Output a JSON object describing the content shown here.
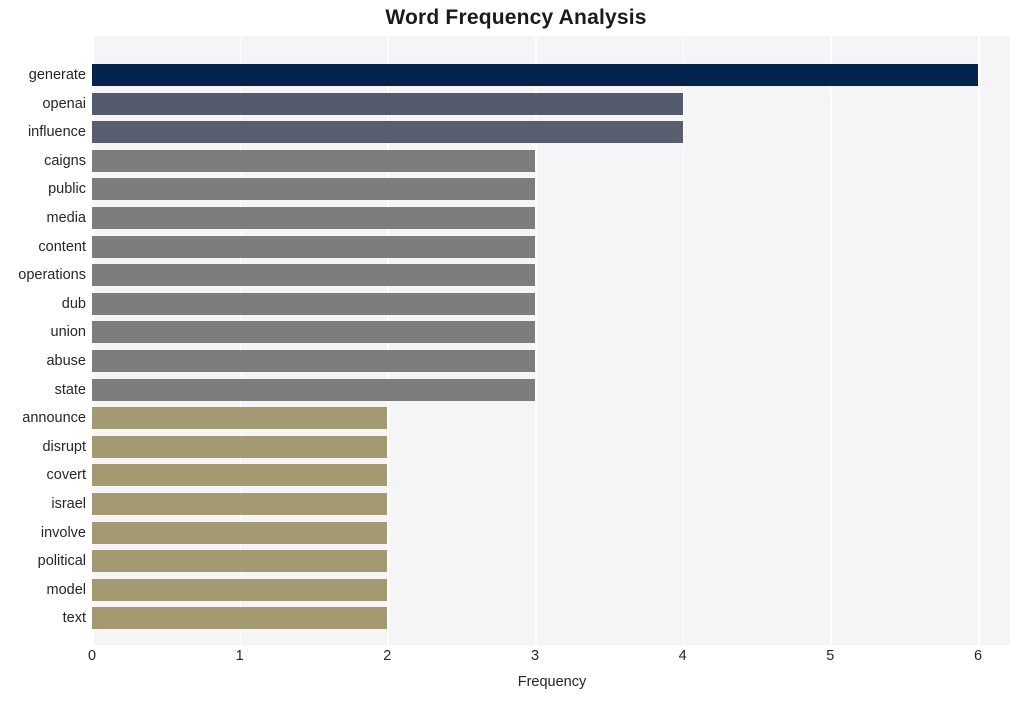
{
  "chart_data": {
    "type": "bar",
    "orientation": "horizontal",
    "title": "Word Frequency Analysis",
    "xlabel": "Frequency",
    "ylabel": "",
    "xlim": [
      0,
      6
    ],
    "xticks": [
      0,
      1,
      2,
      3,
      4,
      5,
      6
    ],
    "xticklabels": [
      "0",
      "1",
      "2",
      "3",
      "4",
      "5",
      "6"
    ],
    "grid": true,
    "grid_axis": "x",
    "legend": null,
    "plot_background": "#f5f5f7",
    "figure_background": "#ffffff",
    "categories": [
      "generate",
      "openai",
      "influence",
      "caigns",
      "public",
      "media",
      "content",
      "operations",
      "dub",
      "union",
      "abuse",
      "state",
      "announce",
      "disrupt",
      "covert",
      "israel",
      "involve",
      "political",
      "model",
      "text"
    ],
    "values": [
      6,
      4,
      4,
      3,
      3,
      3,
      3,
      3,
      3,
      3,
      3,
      3,
      2,
      2,
      2,
      2,
      2,
      2,
      2,
      2
    ],
    "colors": [
      "#04244d",
      "#555b6e",
      "#585e70",
      "#7d7d7b",
      "#7d7d7b",
      "#7d7d7b",
      "#7d7d7b",
      "#7d7d7b",
      "#7d7d7b",
      "#7d7d7b",
      "#7d7d7b",
      "#7d7d7b",
      "#a39a72",
      "#a39a72",
      "#a39a72",
      "#a39a72",
      "#a39a72",
      "#a39a72",
      "#a39a72",
      "#a39a72"
    ],
    "bars": [
      {
        "label": "generate",
        "value": 6,
        "color": "#04244d"
      },
      {
        "label": "openai",
        "value": 4,
        "color": "#555b6e"
      },
      {
        "label": "influence",
        "value": 4,
        "color": "#585e70"
      },
      {
        "label": "caigns",
        "value": 3,
        "color": "#7d7d7b"
      },
      {
        "label": "public",
        "value": 3,
        "color": "#7d7d7b"
      },
      {
        "label": "media",
        "value": 3,
        "color": "#7d7d7b"
      },
      {
        "label": "content",
        "value": 3,
        "color": "#7d7d7b"
      },
      {
        "label": "operations",
        "value": 3,
        "color": "#7d7d7b"
      },
      {
        "label": "dub",
        "value": 3,
        "color": "#7d7d7b"
      },
      {
        "label": "union",
        "value": 3,
        "color": "#7d7d7b"
      },
      {
        "label": "abuse",
        "value": 3,
        "color": "#7d7d7b"
      },
      {
        "label": "state",
        "value": 3,
        "color": "#7d7d7b"
      },
      {
        "label": "announce",
        "value": 2,
        "color": "#a39a72"
      },
      {
        "label": "disrupt",
        "value": 2,
        "color": "#a39a72"
      },
      {
        "label": "covert",
        "value": 2,
        "color": "#a39a72"
      },
      {
        "label": "israel",
        "value": 2,
        "color": "#a39a72"
      },
      {
        "label": "involve",
        "value": 2,
        "color": "#a39a72"
      },
      {
        "label": "political",
        "value": 2,
        "color": "#a39a72"
      },
      {
        "label": "model",
        "value": 2,
        "color": "#a39a72"
      },
      {
        "label": "text",
        "value": 2,
        "color": "#a39a72"
      }
    ]
  }
}
